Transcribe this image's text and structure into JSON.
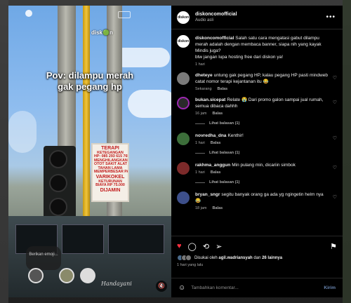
{
  "media": {
    "overlay_line1": "Pov: dilampu merah",
    "overlay_line2": "gak pegang hp",
    "watermark": "disk🟢n",
    "banner_lines": [
      "TERAPI",
      "KETEGANGAN",
      "HP: 085 293 615 765",
      "MENGHILANGKAN",
      "OTOT SAKIT ALAT VITAL",
      "TAHAN LAMA",
      "MEMPERBESAR PANJANG",
      "VARIKOKEL",
      "KETURUNAN",
      "BIAYA RP 75.000",
      "DIJAMIN"
    ],
    "emoji_bubble": "Berikan emoji...",
    "bus_script": "Handayani",
    "mute_icon": "speaker-muted-icon"
  },
  "header": {
    "avatar_text": "diskon",
    "username": "diskoncomofficial",
    "subtitle": "Audio asli",
    "more": "•••"
  },
  "caption": {
    "avatar_text": "diskon",
    "username": "diskoncomofficial",
    "text": "Salah satu cara mengatasi gabut dilampu merah adalah dengan membaca banner, siapa nih yang kayak Mindis juga?",
    "text2": "btw jangan lupa hosting free dari diskon ya!",
    "time": "1 hari"
  },
  "comments": [
    {
      "username": "dheteye",
      "text": "untung gak pegang HP, kalau pegang HP pasti mindweb catat nomor terapi kejantanan itu 😂",
      "time": "Sekarang",
      "reply": "Balas",
      "replies": ""
    },
    {
      "username": "bukan.sicepat",
      "text": "Relate 😭 Dari promo galon sampai jual rumah, semua dibaca dahhh",
      "time": "16 jam",
      "reply": "Balas",
      "replies": "Lihat balasan (1)"
    },
    {
      "username": "novredha_dna",
      "text": "Kenthir!",
      "time": "1 hari",
      "reply": "Balas",
      "replies": "Lihat balasan (1)"
    },
    {
      "username": "rakhma_anggun",
      "text": "Min pulang min, dicariin simbok",
      "time": "1 hari",
      "reply": "Balas",
      "replies": "Lihat balasan (1)"
    },
    {
      "username": "bryan_sngr",
      "text": "segitu banyak orang ga ada yg ngingetin helm nya 😂",
      "time": "18 jam",
      "reply": "Balas",
      "replies": ""
    }
  ],
  "actions": {
    "liked_by_prefix": "Disukai oleh",
    "liked_by_user": "agil.wadriansyah",
    "liked_by_mid": "dan",
    "liked_by_count": "26 lainnya",
    "time_ago": "1 hari yang lalu"
  },
  "composer": {
    "placeholder": "Tambahkan komentar...",
    "send": "Kirim"
  },
  "colors": {
    "like": "#ff3040",
    "send": "#6a87b3",
    "ring": "#9c27b0"
  }
}
